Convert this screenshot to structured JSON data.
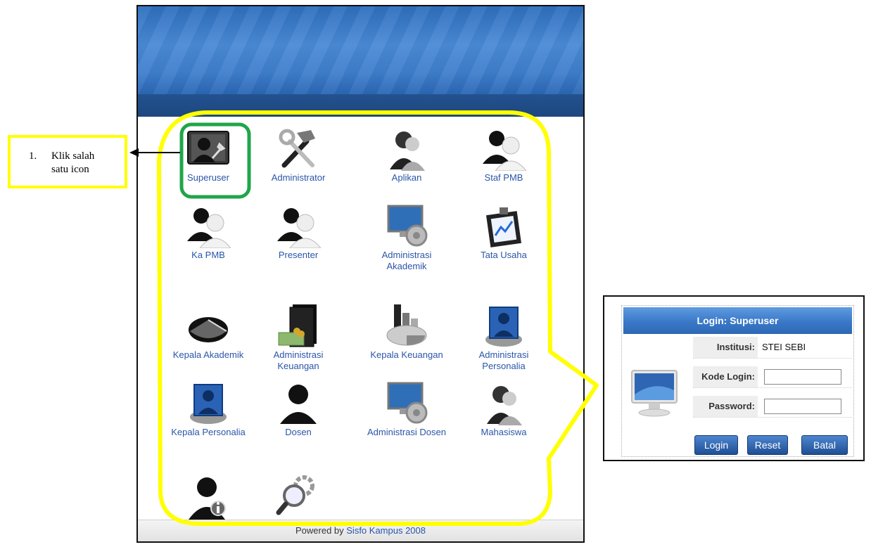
{
  "portal": {
    "footer_prefix": "Powered by",
    "footer_link": "Sisfo Kampus 2008"
  },
  "tiles": [
    {
      "label": "Superuser",
      "icon": "superuser-icon"
    },
    {
      "label": "Administrator",
      "icon": "hammer-wrench-icon"
    },
    {
      "label": "Aplikan",
      "icon": "user-headset-icon"
    },
    {
      "label": "Staf PMB",
      "icon": "users-icon"
    },
    {
      "label": "Ka PMB",
      "icon": "users-icon"
    },
    {
      "label": "Presenter",
      "icon": "users-icon"
    },
    {
      "label": "Administrasi Akademik",
      "icon": "monitor-gear-icon"
    },
    {
      "label": "Tata Usaha",
      "icon": "clipboard-chart-icon"
    },
    {
      "label": "Kepala Akademik",
      "icon": "pie-chart-icon"
    },
    {
      "label": "Administrasi Keuangan",
      "icon": "money-folder-icon"
    },
    {
      "label": "Kepala Keuangan",
      "icon": "bar-pie-icon"
    },
    {
      "label": "Administrasi Personalia",
      "icon": "person-screen-icon"
    },
    {
      "label": "Kepala Personalia",
      "icon": "person-screen-icon"
    },
    {
      "label": "Dosen",
      "icon": "user-icon"
    },
    {
      "label": "Administrasi Dosen",
      "icon": "monitor-gear-icon"
    },
    {
      "label": "Mahasiswa",
      "icon": "user-headset-icon"
    },
    {
      "label": "",
      "icon": "user-info-icon"
    },
    {
      "label": "",
      "icon": "search-gear-icon"
    }
  ],
  "callout": {
    "number": "1.",
    "line1": "Klik salah",
    "line2": "satu icon"
  },
  "login": {
    "title": "Login: Superuser",
    "institusi_label": "Institusi:",
    "institusi_value": "STEI SEBI",
    "kode_label": "Kode Login:",
    "kode_value": "",
    "password_label": "Password:",
    "password_value": "",
    "btn_login": "Login",
    "btn_reset": "Reset",
    "btn_batal": "Batal"
  },
  "colors": {
    "highlight_yellow": "#ffff00",
    "highlight_green": "#1fa64a",
    "link_blue": "#2a55a8"
  }
}
